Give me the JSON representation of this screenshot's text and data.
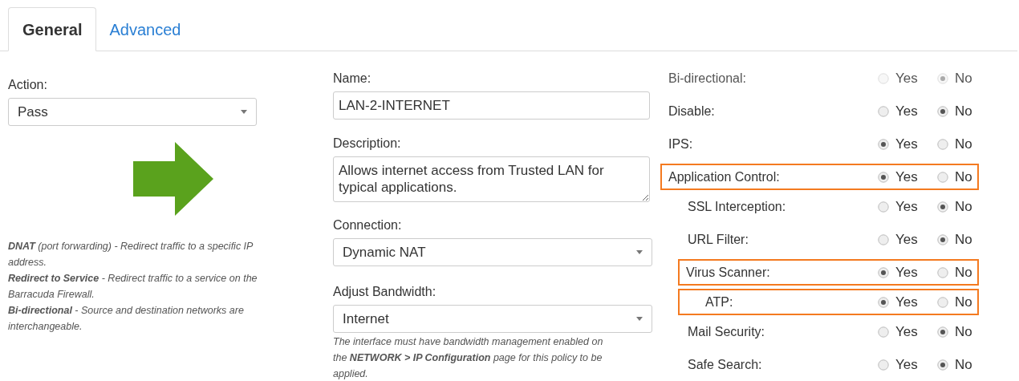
{
  "tabs": [
    {
      "label": "General",
      "selected": true
    },
    {
      "label": "Advanced",
      "selected": false
    }
  ],
  "action": {
    "label": "Action:",
    "value": "Pass"
  },
  "help_text": [
    "**DNAT** (port forwarding) - Redirect traffic to a specific IP address.",
    "**Redirect to Service** - Redirect traffic to a service on the Barracuda Firewall.",
    "**Bi-directional** - Source and destination networks are interchangeable."
  ],
  "name": {
    "label": "Name:",
    "value": "LAN-2-INTERNET"
  },
  "description": {
    "label": "Description:",
    "value": "Allows internet access from Trusted LAN for typical applications."
  },
  "connection": {
    "label": "Connection:",
    "value": "Dynamic NAT"
  },
  "adjust_bandwidth": {
    "label": "Adjust Bandwidth:",
    "value": "Internet",
    "note": "The interface must have bandwidth management enabled on the **NETWORK > IP Configuration** page for this policy to be applied."
  },
  "settings": [
    {
      "label": "Bi-directional:",
      "disabled": true,
      "highlighted": false,
      "options": [
        {
          "label": "Yes",
          "selected": false
        },
        {
          "label": "No",
          "selected": true
        }
      ]
    },
    {
      "label": "Disable:",
      "disabled": false,
      "highlighted": false,
      "options": [
        {
          "label": "Yes",
          "selected": false
        },
        {
          "label": "No",
          "selected": true
        }
      ]
    },
    {
      "label": "IPS:",
      "disabled": false,
      "highlighted": false,
      "options": [
        {
          "label": "Yes",
          "selected": true
        },
        {
          "label": "No",
          "selected": false
        }
      ]
    },
    {
      "label": "Application Control:",
      "disabled": false,
      "highlighted": true,
      "options": [
        {
          "label": "Yes",
          "selected": true
        },
        {
          "label": "No",
          "selected": false
        }
      ],
      "children": [
        {
          "label": "SSL Interception:",
          "disabled": false,
          "highlighted": false,
          "options": [
            {
              "label": "Yes",
              "selected": false
            },
            {
              "label": "No",
              "selected": true
            }
          ]
        },
        {
          "label": "URL Filter:",
          "disabled": false,
          "highlighted": false,
          "options": [
            {
              "label": "Yes",
              "selected": false
            },
            {
              "label": "No",
              "selected": true
            }
          ]
        },
        {
          "label": "Virus Scanner:",
          "disabled": false,
          "highlighted": true,
          "options": [
            {
              "label": "Yes",
              "selected": true
            },
            {
              "label": "No",
              "selected": false
            }
          ],
          "children": [
            {
              "label": "ATP:",
              "disabled": false,
              "highlighted": true,
              "options": [
                {
                  "label": "Yes",
                  "selected": true
                },
                {
                  "label": "No",
                  "selected": false
                }
              ]
            }
          ]
        },
        {
          "label": "Mail Security:",
          "disabled": false,
          "highlighted": false,
          "options": [
            {
              "label": "Yes",
              "selected": false
            },
            {
              "label": "No",
              "selected": true
            }
          ]
        },
        {
          "label": "Safe Search:",
          "disabled": false,
          "highlighted": false,
          "options": [
            {
              "label": "Yes",
              "selected": false
            },
            {
              "label": "No",
              "selected": true
            }
          ]
        }
      ]
    }
  ]
}
